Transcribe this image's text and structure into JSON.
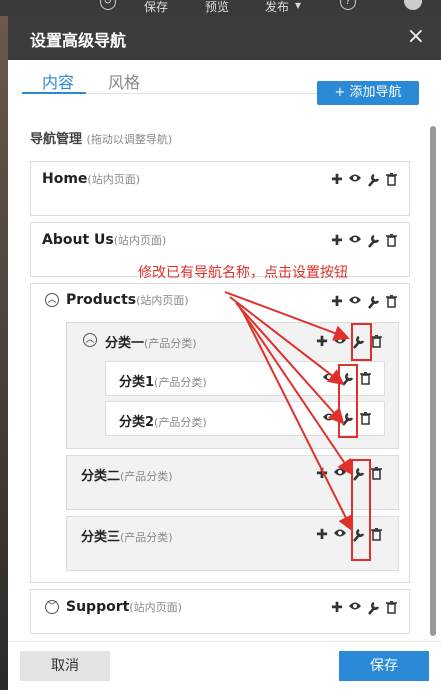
{
  "topbar": {
    "save": "保存",
    "preview": "预览",
    "publish": "发布",
    "help": "?"
  },
  "modal": {
    "title": "设置高级导航",
    "close": "×"
  },
  "tabs": [
    {
      "label": "内容",
      "active": true
    },
    {
      "label": "风格",
      "active": false
    }
  ],
  "add_button": "+ 添加导航",
  "section": {
    "title": "导航管理",
    "hint": "(拖动以调整导航)"
  },
  "annotation": "修改已有导航名称，点击设置按钮",
  "items": [
    {
      "name": "Home",
      "type": "(站内页面)"
    },
    {
      "name": "About Us",
      "type": "(站内页面)"
    },
    {
      "name": "Products",
      "type": "(站内页面)",
      "toggle": "︿"
    },
    {
      "name": "分类一",
      "type": "(产品分类)",
      "toggle": "︿"
    },
    {
      "name": "分类1",
      "type": "(产品分类)"
    },
    {
      "name": "分类2",
      "type": "(产品分类)"
    },
    {
      "name": "分类二",
      "type": "(产品分类)"
    },
    {
      "name": "分类三",
      "type": "(产品分类)"
    },
    {
      "name": "Support",
      "type": "(站内页面)",
      "toggle": "﹀"
    }
  ],
  "icons": {
    "add": "plus-icon",
    "view": "eye-icon",
    "settings": "wrench-icon",
    "delete": "trash-icon"
  },
  "colors": {
    "accent": "#2a8ad8",
    "highlight": "#e0302c",
    "header": "#3c3c3c"
  },
  "footer": {
    "cancel": "取消",
    "save": "保存"
  }
}
